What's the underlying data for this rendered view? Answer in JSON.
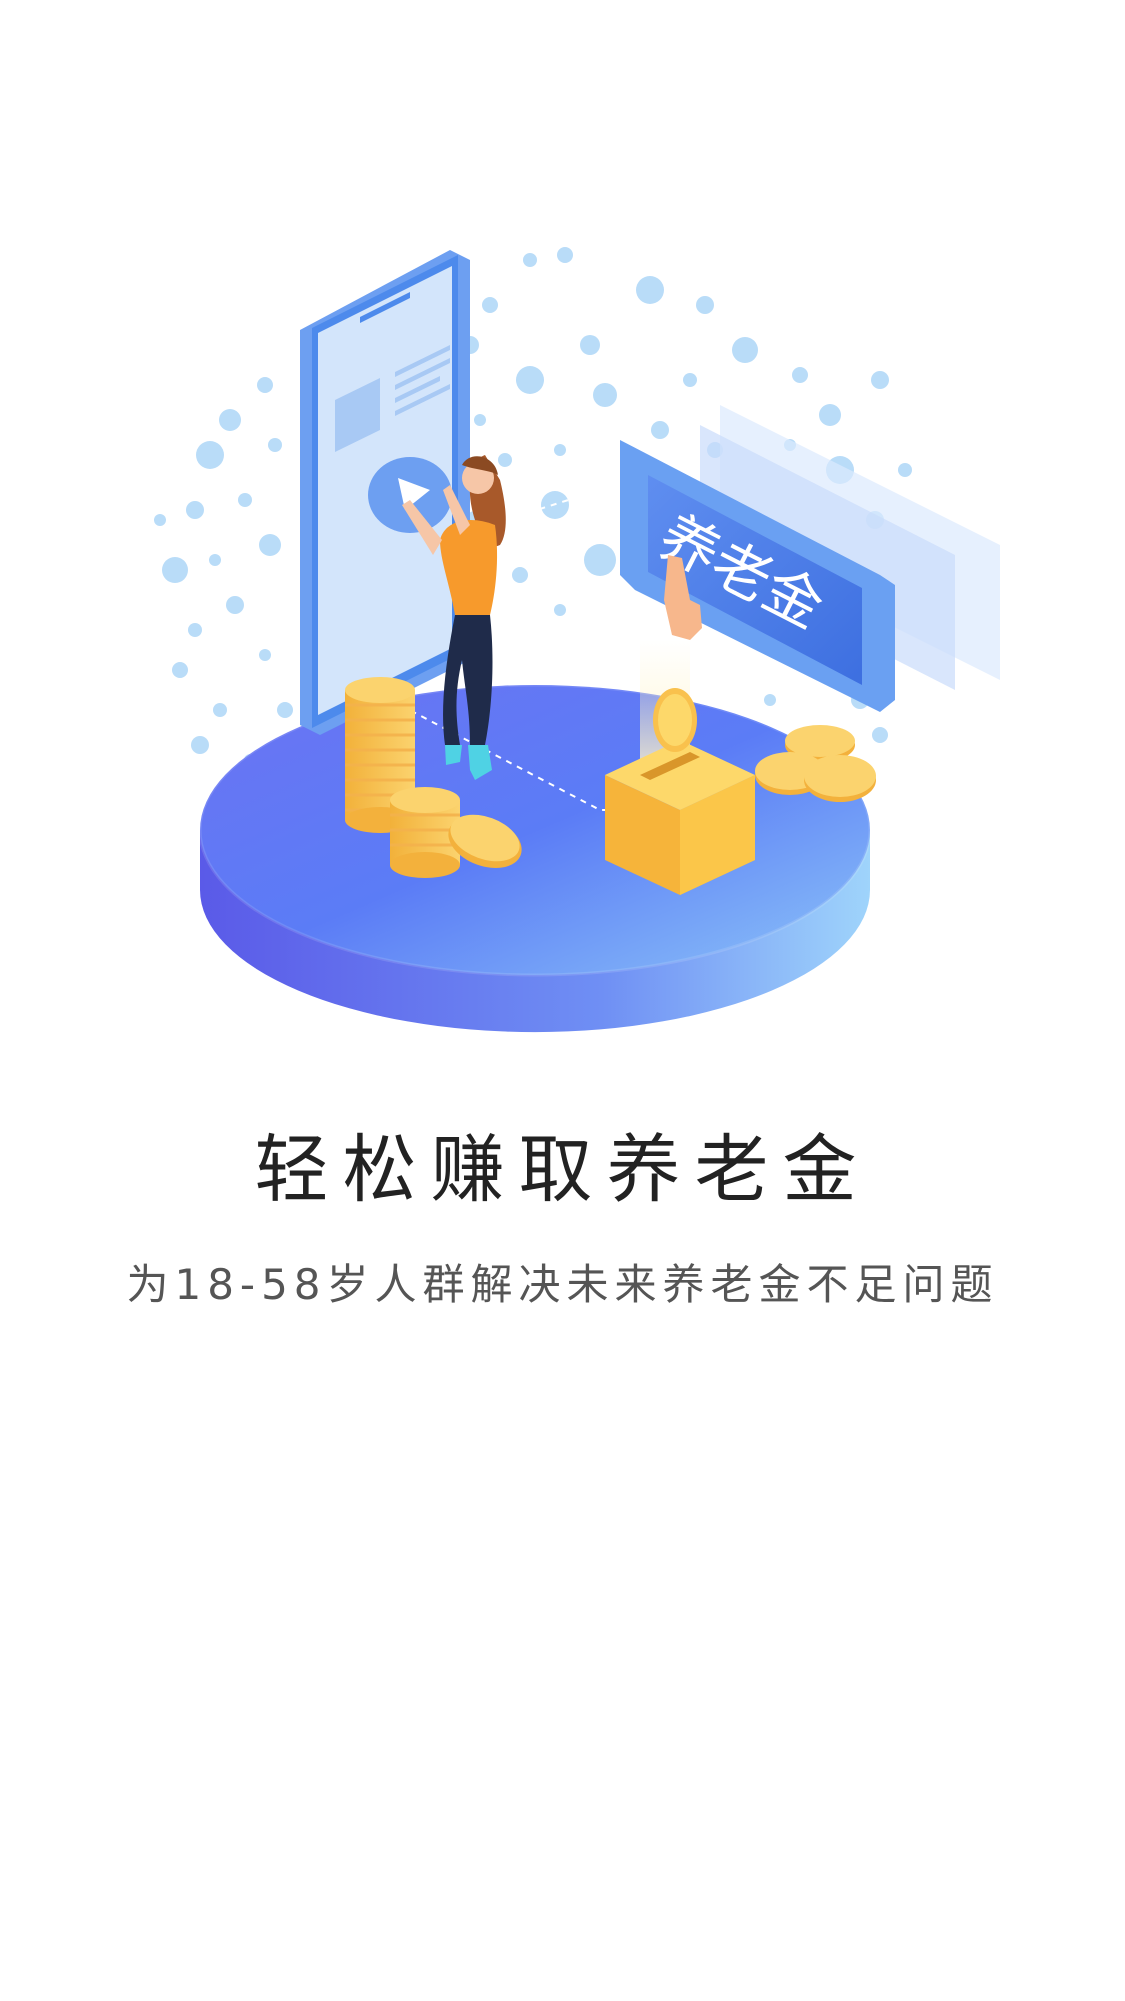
{
  "onboarding": {
    "title": "轻松赚取养老金",
    "subtitle": "为18-58岁人群解决未来养老金不足问题"
  },
  "illustration": {
    "sign_text": "养老金",
    "icons": [
      "smartphone-icon",
      "woman-figure",
      "coin-stack-icon",
      "donation-box-icon",
      "sign-card-icon"
    ]
  },
  "colors": {
    "platform_blue": "#5a79f5",
    "platform_side": "#4d63e8",
    "coin_gold": "#f9c14d",
    "dots_blue": "#9fd0f5",
    "title_text": "#222222",
    "subtitle_text": "#555555"
  }
}
